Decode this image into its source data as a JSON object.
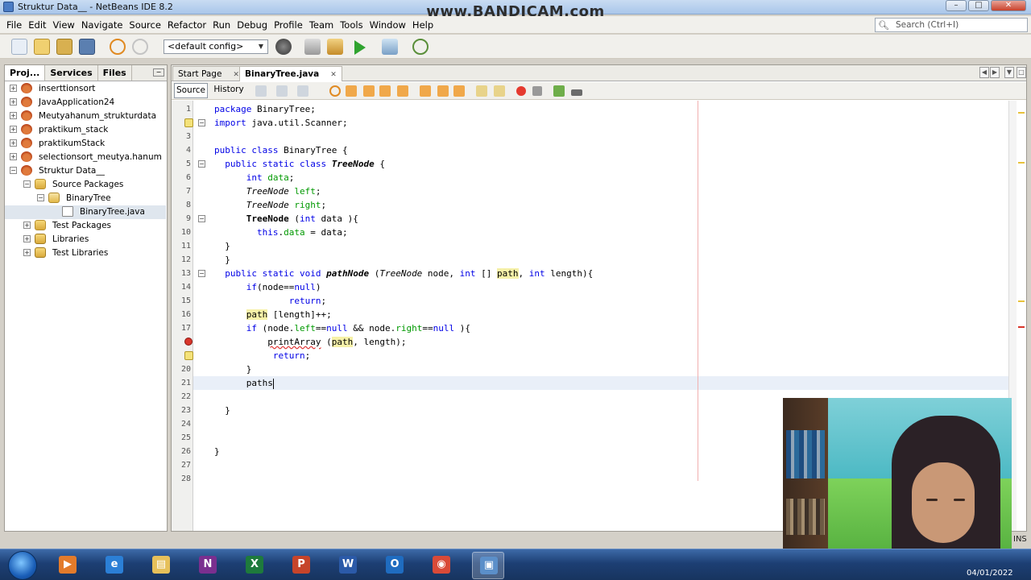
{
  "window": {
    "title": "Struktur Data__ - NetBeans IDE 8.2",
    "watermark": "www.BANDICAM.com",
    "buttons": [
      "–",
      "□",
      "✕"
    ]
  },
  "menu": [
    "File",
    "Edit",
    "View",
    "Navigate",
    "Source",
    "Refactor",
    "Run",
    "Debug",
    "Profile",
    "Team",
    "Tools",
    "Window",
    "Help"
  ],
  "search": {
    "placeholder": "Search (Ctrl+I)"
  },
  "toolbar": {
    "config_value": "<default config>"
  },
  "left_panel": {
    "tabs": [
      "Proj...",
      "Services",
      "Files"
    ],
    "tree": [
      {
        "label": "inserttionsort",
        "icon": "project-icon",
        "level": 0,
        "expander": "+"
      },
      {
        "label": "JavaApplication24",
        "icon": "project-icon",
        "level": 0,
        "expander": "+"
      },
      {
        "label": "Meutyahanum_strukturdata",
        "icon": "project-icon",
        "level": 0,
        "expander": "+"
      },
      {
        "label": "praktikum_stack",
        "icon": "project-icon",
        "level": 0,
        "expander": "+"
      },
      {
        "label": "praktikumStack",
        "icon": "project-icon",
        "level": 0,
        "expander": "+"
      },
      {
        "label": "selectionsort_meutya.hanum",
        "icon": "project-icon",
        "level": 0,
        "expander": "+"
      },
      {
        "label": "Struktur Data__",
        "icon": "project-icon",
        "level": 0,
        "expander": "−"
      },
      {
        "label": "Source Packages",
        "icon": "folder-icon",
        "level": 1,
        "expander": "−"
      },
      {
        "label": "BinaryTree",
        "icon": "package-icon",
        "level": 2,
        "expander": "−"
      },
      {
        "label": "BinaryTree.java",
        "icon": "java-file-icon",
        "level": 3,
        "expander": ""
      },
      {
        "label": "Test Packages",
        "icon": "folder-icon",
        "level": 1,
        "expander": "+"
      },
      {
        "label": "Libraries",
        "icon": "library-icon",
        "level": 1,
        "expander": "+"
      },
      {
        "label": "Test Libraries",
        "icon": "library-icon",
        "level": 1,
        "expander": "+"
      }
    ]
  },
  "editor": {
    "tabs": [
      {
        "label": "Start Page",
        "close": "✕"
      },
      {
        "label": "BinaryTree.java",
        "close": "✕"
      }
    ],
    "source_label": "Source",
    "history_label": "History",
    "lines": [
      {
        "n": "1",
        "html": "<span class='kw'>package</span> BinaryTree;"
      },
      {
        "n": "2",
        "html": "<span class='kw'>import</span> java.util.Scanner;"
      },
      {
        "n": "3",
        "html": ""
      },
      {
        "n": "4",
        "html": "<span class='kw'>public class</span> BinaryTree {"
      },
      {
        "n": "5",
        "html": "  <span class='kw'>public static class</span> <span class='it'>TreeNode</span> {"
      },
      {
        "n": "6",
        "html": "      <span class='kw'>int</span> <span class='fld'>data</span>;"
      },
      {
        "n": "7",
        "html": "      <span class='it' style='font-weight:normal'>TreeNode</span> <span class='fld'>left</span>;"
      },
      {
        "n": "8",
        "html": "      <span class='it' style='font-weight:normal'>TreeNode</span> <span class='fld'>right</span>;"
      },
      {
        "n": "9",
        "html": "      <b>TreeNode</b> (<span class='kw'>int</span> data ){"
      },
      {
        "n": "10",
        "html": "        <span class='kw'>this</span>.<span class='fld'>data</span> = data;"
      },
      {
        "n": "11",
        "html": "  }"
      },
      {
        "n": "12",
        "html": "  }"
      },
      {
        "n": "13",
        "html": "  <span class='kw'>public static void</span> <span class='it'>pathNode</span> (<span class='it' style='font-weight:normal'>TreeNode</span> node, <span class='kw'>int</span> [] <span class='hl'>path</span>, <span class='kw'>int</span> length){"
      },
      {
        "n": "14",
        "html": "      <span class='kw'>if</span>(node==<span class='kw'>null</span>)"
      },
      {
        "n": "15",
        "html": "              <span class='kw'>return</span>;"
      },
      {
        "n": "16",
        "html": "      <span class='hl'>path</span> [length]++;"
      },
      {
        "n": "17",
        "html": "      <span class='kw'>if</span> (node.<span class='fld'>left</span>==<span class='kw'>null</span> &amp;&amp; node.<span class='fld'>right</span>==<span class='kw'>null</span> ){"
      },
      {
        "n": "",
        "html": "          <span class='err'>printArray</span> (<span class='hl'>path</span>, length);"
      },
      {
        "n": "",
        "html": "           <span class='kw'>return</span>;"
      },
      {
        "n": "20",
        "html": "      }"
      },
      {
        "n": "21",
        "html": "      paths"
      },
      {
        "n": "22",
        "html": ""
      },
      {
        "n": "23",
        "html": "  }"
      },
      {
        "n": "24",
        "html": ""
      },
      {
        "n": "25",
        "html": ""
      },
      {
        "n": "26",
        "html": "}"
      },
      {
        "n": "27",
        "html": ""
      },
      {
        "n": "28",
        "html": ""
      }
    ]
  },
  "status": {
    "ins": "INS"
  },
  "taskbar": {
    "apps": [
      {
        "name": "media-player-icon",
        "glyph": "▶",
        "color": "#e37b2b"
      },
      {
        "name": "internet-explorer-icon",
        "glyph": "e",
        "color": "#2b7fd6"
      },
      {
        "name": "file-explorer-icon",
        "glyph": "▤",
        "color": "#e6c05a"
      },
      {
        "name": "onenote-icon",
        "glyph": "N",
        "color": "#7a2f8f"
      },
      {
        "name": "excel-icon",
        "glyph": "X",
        "color": "#1e7a3c"
      },
      {
        "name": "powerpoint-icon",
        "glyph": "P",
        "color": "#c6442a"
      },
      {
        "name": "word-icon",
        "glyph": "W",
        "color": "#2b5aa8"
      },
      {
        "name": "outlook-icon",
        "glyph": "O",
        "color": "#1f6cc0"
      },
      {
        "name": "chrome-icon",
        "glyph": "◉",
        "color": "#d94a38"
      },
      {
        "name": "netbeans-icon",
        "glyph": "▣",
        "color": "#5b8fc9"
      }
    ],
    "date": "04/01/2022"
  }
}
